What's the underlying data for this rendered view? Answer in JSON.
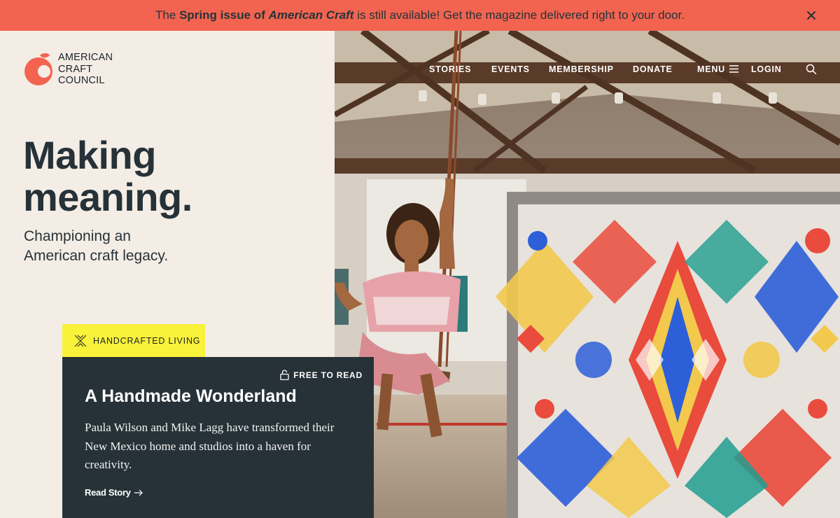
{
  "banner": {
    "prefix": "The ",
    "issue": "Spring issue of ",
    "magazine": "American Craft",
    "suffix": " is still available! Get the magazine delivered right to your door."
  },
  "logo": {
    "line1": "AMERICAN",
    "line2": "CRAFT",
    "line3": "COUNCIL"
  },
  "nav": {
    "stories": "STORIES",
    "events": "EVENTS",
    "membership": "MEMBERSHIP",
    "donate": "DONATE",
    "menu": "MENU",
    "login": "LOGIN"
  },
  "hero": {
    "title_line1": "Making",
    "title_line2": "meaning.",
    "subtitle_line1": "Championing an",
    "subtitle_line2": "American craft legacy."
  },
  "feature": {
    "category": "HANDCRAFTED LIVING",
    "access": "FREE TO READ",
    "title": "A Handmade Wonderland",
    "body": "Paula Wilson and Mike Lagg have transformed their New Mexico home and studios into a haven for creativity.",
    "cta": "Read Story"
  },
  "colors": {
    "banner": "#f26450",
    "background": "#f4ede6",
    "card": "#263238",
    "tag": "#f9f23a"
  }
}
